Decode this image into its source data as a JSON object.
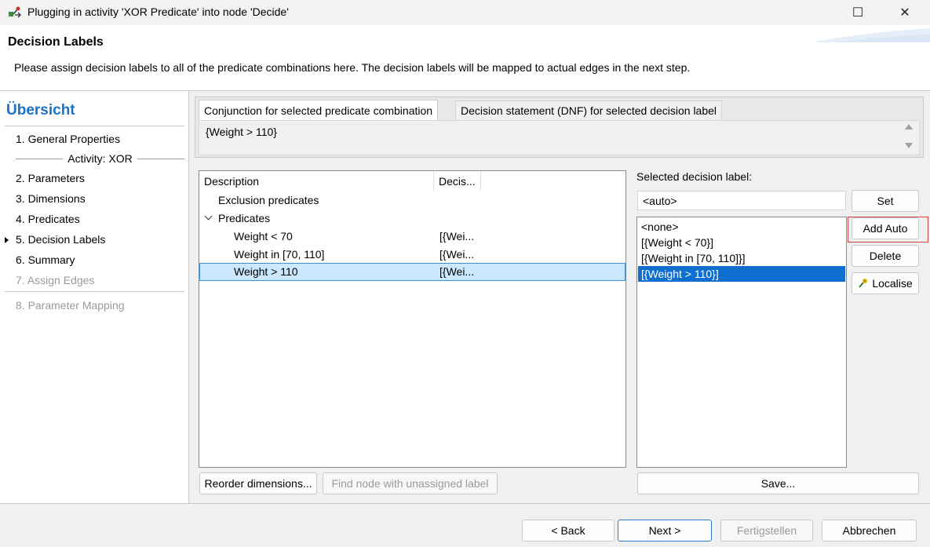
{
  "window": {
    "title": "Plugging in activity 'XOR Predicate' into node 'Decide'",
    "maximize_glyph": "☐",
    "close_glyph": "✕"
  },
  "header": {
    "title": "Decision Labels",
    "description": "Please assign decision labels to all of the predicate combinations here. The decision labels will be mapped to actual edges in the next step."
  },
  "sidebar": {
    "title": "Übersicht",
    "items": [
      {
        "label": "1. General Properties"
      },
      {
        "label": "2. Parameters"
      },
      {
        "label": "3. Dimensions"
      },
      {
        "label": "4. Predicates"
      },
      {
        "label": "5. Decision Labels",
        "active": true
      },
      {
        "label": "6. Summary"
      },
      {
        "label": "7. Assign Edges",
        "disabled": true
      },
      {
        "label": "8. Parameter Mapping",
        "disabled": true
      }
    ],
    "group_label": "Activity: XOR"
  },
  "tabs": [
    {
      "label": "Conjunction for selected predicate combination",
      "selected": true
    },
    {
      "label": "Decision statement (DNF) for selected decision label",
      "selected": false
    }
  ],
  "conjunction_text": "{Weight > 110}",
  "tree_table": {
    "columns": [
      "Description",
      "Decis..."
    ],
    "rows": [
      {
        "description": "Exclusion predicates",
        "decision": ""
      },
      {
        "description": "Predicates",
        "decision": "",
        "expanded": true
      },
      {
        "description": "Weight < 70",
        "decision": "[{Wei..."
      },
      {
        "description": "Weight in [70, 110]",
        "decision": "[{Wei..."
      },
      {
        "description": "Weight > 110",
        "decision": "[{Wei...",
        "selected": true
      }
    ]
  },
  "decision_panel": {
    "selected_label_caption": "Selected decision label:",
    "selected_label_value": "<auto>",
    "labels": [
      {
        "label": "<none>"
      },
      {
        "label": "[{Weight < 70}]"
      },
      {
        "label": "[{Weight in [70, 110]}]"
      },
      {
        "label": "[{Weight > 110}]",
        "selected": true
      }
    ],
    "buttons": {
      "set": "Set",
      "add_auto": "Add Auto",
      "delete": "Delete",
      "localise": "Localise",
      "save": "Save..."
    }
  },
  "bottom_buttons": {
    "reorder": "Reorder dimensions...",
    "find_node": "Find node with unassigned label"
  },
  "footer": {
    "back": "< Back",
    "next": "Next >",
    "finish": "Fertigstellen",
    "cancel": "Abbrechen"
  }
}
